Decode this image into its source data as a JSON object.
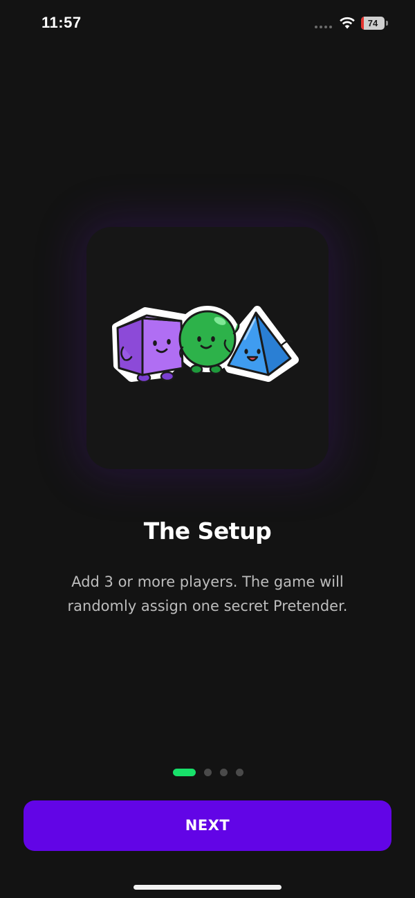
{
  "status_bar": {
    "time": "11:57",
    "battery_level": "74",
    "battery_color": "#e5342f"
  },
  "onboarding": {
    "title": "The Setup",
    "description": "Add 3 or more players. The game will randomly assign one secret Pretender.",
    "pages_total": 4,
    "current_page": 1,
    "active_dot_color": "#18e06a",
    "illustration_icons": [
      "purple-cube-mascot-icon",
      "green-ball-mascot-icon",
      "blue-pyramid-mascot-icon"
    ]
  },
  "actions": {
    "next_label": "NEXT",
    "accent_color": "#6205e6"
  }
}
